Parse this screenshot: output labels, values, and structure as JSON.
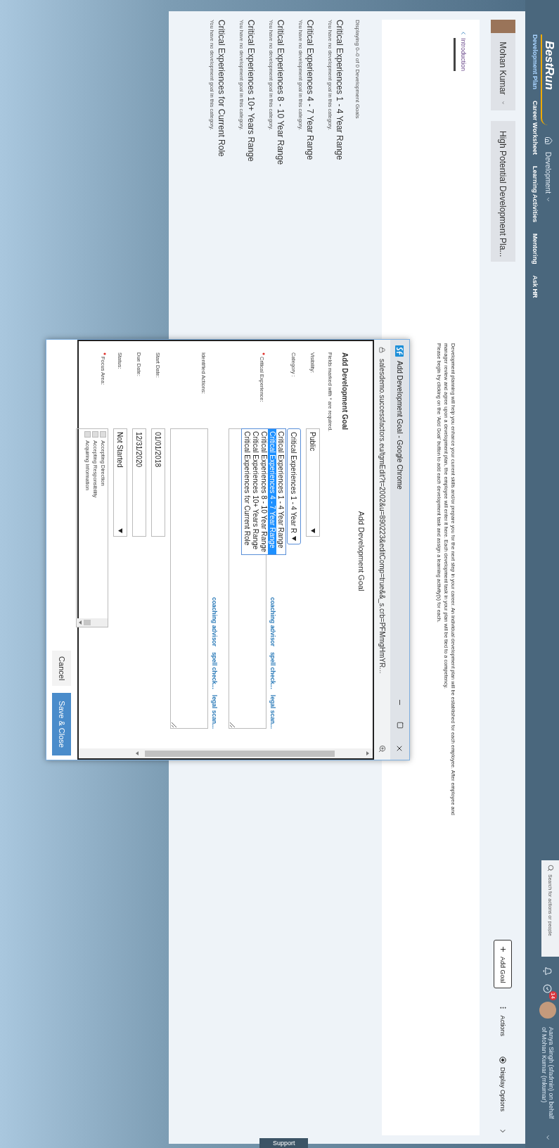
{
  "header": {
    "logo": "BestRun",
    "module": "Development",
    "nav": [
      {
        "label": "Development Plan",
        "selected": true
      },
      {
        "label": "Career Worksheet",
        "selected": false
      },
      {
        "label": "Learning Activities",
        "selected": false
      },
      {
        "label": "Mentoring",
        "selected": false
      },
      {
        "label": "Ask HR",
        "selected": false
      }
    ],
    "search": {
      "placeholder": "Search for actions or people"
    },
    "notification_count": "14",
    "user": "Aanya Singh (sfadmin) on behalf of Mohan Kumar (mkumar)"
  },
  "toolbar": {
    "person": "Mohan Kumar",
    "plan": "High Potential Development Pla...",
    "actions": [
      {
        "label": "Add Goal",
        "kind": "add"
      },
      {
        "label": "Actions",
        "kind": "more"
      },
      {
        "label": "Display Options",
        "kind": "options"
      }
    ]
  },
  "intro": {
    "tab": "Introduction",
    "paragraphs": [
      "Development planning will help you enhance your current skills and/or prepare you for the next step in your career.  An individual development plan will be established for each employee. After employee and manager review and agree upon a development plan, the employee will enter it here. Each development task in your plan will be tied to a competency.",
      "Please begin by clicking on the 'Add Goal' button to add each development task and assign a learning activity(s) for each."
    ]
  },
  "goals": {
    "summary": "Displaying 0–0 of 0 Development Goals",
    "categories": [
      {
        "title": "Critical Experiences 1 - 4 Year Range",
        "message": "You have no development goal in this category."
      },
      {
        "title": "Critical Experiences 4 - 7 Year Range",
        "message": "You have no development goal in this category."
      },
      {
        "title": "Critical Experiences 8 - 10 Year Range",
        "message": "You have no development goal in this category."
      },
      {
        "title": "Critical Experiences 10+ Years Range",
        "message": "You have no development goal in this category."
      },
      {
        "title": "Critical Experiences for Current Role",
        "message": "You have no development goal in this category."
      }
    ]
  },
  "dialog_window": {
    "title": "Add Development Goal - Google Chrome",
    "url": "salesdemo.successfactors.eu/tgmEdit?t=2002&u=890223&editComp=true&&_s.crb=PFMmgHmYR...",
    "page_title": "Add Development Goal",
    "form_title": "Add Development Goal",
    "required_note": "Fields marked with * are required.",
    "fields": [
      {
        "label": "Visibility:",
        "kind": "select",
        "value": "Public",
        "required": false,
        "open": false
      },
      {
        "label": "Category :",
        "kind": "select",
        "value": "Critical Experiences 1 - 4 Year R",
        "required": false,
        "open": true,
        "options": [
          {
            "label": "Critical Experiences 1 - 4 Year Range",
            "selected": false
          },
          {
            "label": "Critical Experiences 4 - 7 Year Range",
            "selected": true
          },
          {
            "label": "Critical Experiences 8 - 10 Year Range",
            "selected": false
          },
          {
            "label": "Critical Experiences 10+ Years Range",
            "selected": false
          },
          {
            "label": "Critical Experiences for Current Role",
            "selected": false
          }
        ]
      },
      {
        "label": "Critical Experience:",
        "kind": "textarea",
        "required": true,
        "links": [
          "coaching advisor",
          "spell check...",
          "legal scan..."
        ]
      },
      {
        "label": "Identified Actions:",
        "kind": "textarea",
        "required": false,
        "links": [
          "coaching advisor",
          "spell check...",
          "legal scan..."
        ]
      },
      {
        "label": "Start Date:",
        "kind": "text",
        "value": "01/01/2018",
        "required": false
      },
      {
        "label": "Due Date:",
        "kind": "text",
        "value": "12/31/2020",
        "required": false
      },
      {
        "label": "Status:",
        "kind": "select",
        "value": "Not Started",
        "required": false,
        "open": false
      },
      {
        "label": "Focus Area:",
        "kind": "checklist",
        "required": true,
        "options": [
          {
            "label": "Accepting Direction",
            "checked": false
          },
          {
            "label": "Accepting Responsibility",
            "checked": false
          },
          {
            "label": "Acquiring Information",
            "checked": false
          }
        ]
      }
    ],
    "buttons": [
      {
        "label": "Cancel",
        "kind": "secondary"
      },
      {
        "label": "Save & Close",
        "kind": "primary"
      }
    ]
  },
  "support_tab": "Support"
}
